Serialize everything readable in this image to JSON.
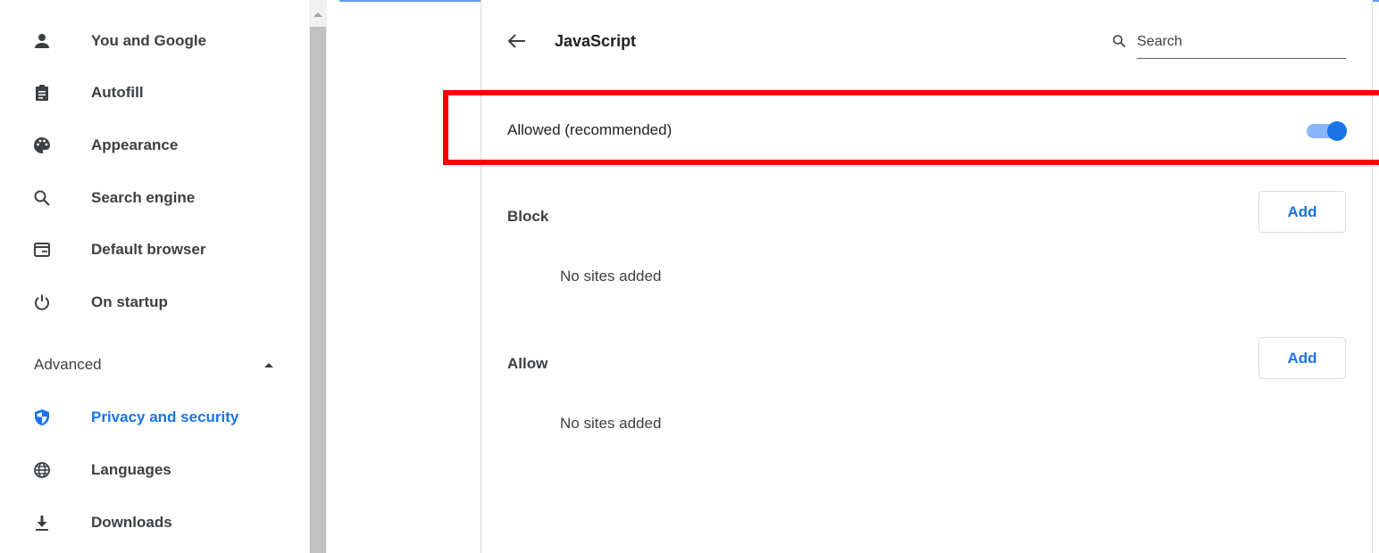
{
  "sidebar": {
    "items": [
      {
        "label": "You and Google",
        "icon": "person-icon"
      },
      {
        "label": "Autofill",
        "icon": "clipboard-icon"
      },
      {
        "label": "Appearance",
        "icon": "palette-icon"
      },
      {
        "label": "Search engine",
        "icon": "search-icon"
      },
      {
        "label": "Default browser",
        "icon": "browser-window-icon"
      },
      {
        "label": "On startup",
        "icon": "power-icon"
      }
    ],
    "advanced_label": "Advanced",
    "advanced_items": [
      {
        "label": "Privacy and security",
        "icon": "shield-icon",
        "active": true
      },
      {
        "label": "Languages",
        "icon": "globe-icon"
      },
      {
        "label": "Downloads",
        "icon": "download-icon"
      }
    ]
  },
  "header": {
    "title": "JavaScript",
    "search_placeholder": "Search"
  },
  "setting": {
    "label": "Allowed (recommended)",
    "enabled": true
  },
  "block": {
    "heading": "Block",
    "add_label": "Add",
    "empty_text": "No sites added"
  },
  "allow": {
    "heading": "Allow",
    "add_label": "Add",
    "empty_text": "No sites added"
  },
  "colors": {
    "accent": "#1a73e8",
    "toggle_track": "#8ab4f8",
    "highlight": "#ff0000"
  }
}
